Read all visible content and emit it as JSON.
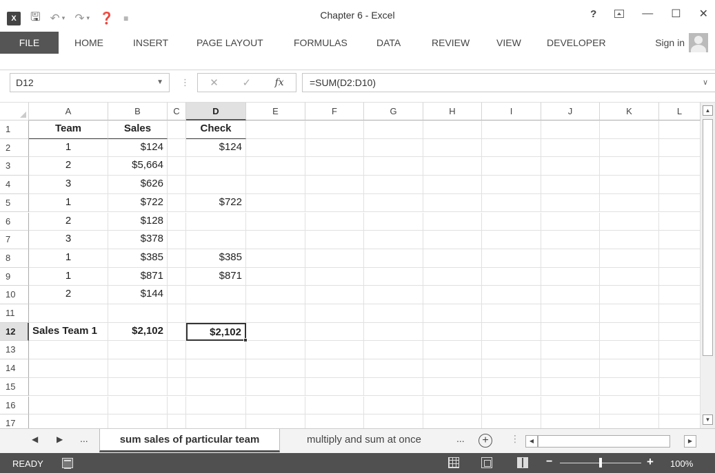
{
  "app": {
    "title": "Chapter 6 - Excel",
    "logo": "X",
    "help": "?"
  },
  "ribbon": {
    "tabs": [
      "FILE",
      "HOME",
      "INSERT",
      "PAGE LAYOUT",
      "FORMULAS",
      "DATA",
      "REVIEW",
      "VIEW",
      "DEVELOPER"
    ],
    "sign_in": "Sign in"
  },
  "formula_bar": {
    "name_box": "D12",
    "formula": "=SUM(D2:D10)",
    "fx": "fx"
  },
  "grid": {
    "columns": [
      "A",
      "B",
      "C",
      "D",
      "E",
      "F",
      "G",
      "H",
      "I",
      "J",
      "K",
      "L"
    ],
    "selected_column": "D",
    "selected_row": "12",
    "rows": [
      {
        "num": "1",
        "A": "Team",
        "B": "Sales",
        "D": "Check"
      },
      {
        "num": "2",
        "A": "1",
        "B": "$124",
        "D": "$124"
      },
      {
        "num": "3",
        "A": "2",
        "B": "$5,664",
        "D": ""
      },
      {
        "num": "4",
        "A": "3",
        "B": "$626",
        "D": ""
      },
      {
        "num": "5",
        "A": "1",
        "B": "$722",
        "D": "$722"
      },
      {
        "num": "6",
        "A": "2",
        "B": "$128",
        "D": ""
      },
      {
        "num": "7",
        "A": "3",
        "B": "$378",
        "D": ""
      },
      {
        "num": "8",
        "A": "1",
        "B": "$385",
        "D": "$385"
      },
      {
        "num": "9",
        "A": "1",
        "B": "$871",
        "D": "$871"
      },
      {
        "num": "10",
        "A": "2",
        "B": "$144",
        "D": ""
      },
      {
        "num": "11",
        "A": "",
        "B": "",
        "D": ""
      },
      {
        "num": "12",
        "A": "Sales Team 1",
        "B": "$2,102",
        "D": "$2,102"
      },
      {
        "num": "13",
        "A": "",
        "B": "",
        "D": ""
      },
      {
        "num": "14",
        "A": "",
        "B": "",
        "D": ""
      },
      {
        "num": "15",
        "A": "",
        "B": "",
        "D": ""
      },
      {
        "num": "16",
        "A": "",
        "B": "",
        "D": ""
      },
      {
        "num": "17",
        "A": "",
        "B": "",
        "D": ""
      }
    ]
  },
  "sheets": {
    "nav_more": "...",
    "tabs": [
      "sum sales of particular team",
      "multiply and sum at once"
    ],
    "active": 0,
    "more": "...",
    "add": "+"
  },
  "status": {
    "ready": "READY",
    "zoom": "100%",
    "zoom_level_percent": 100
  }
}
